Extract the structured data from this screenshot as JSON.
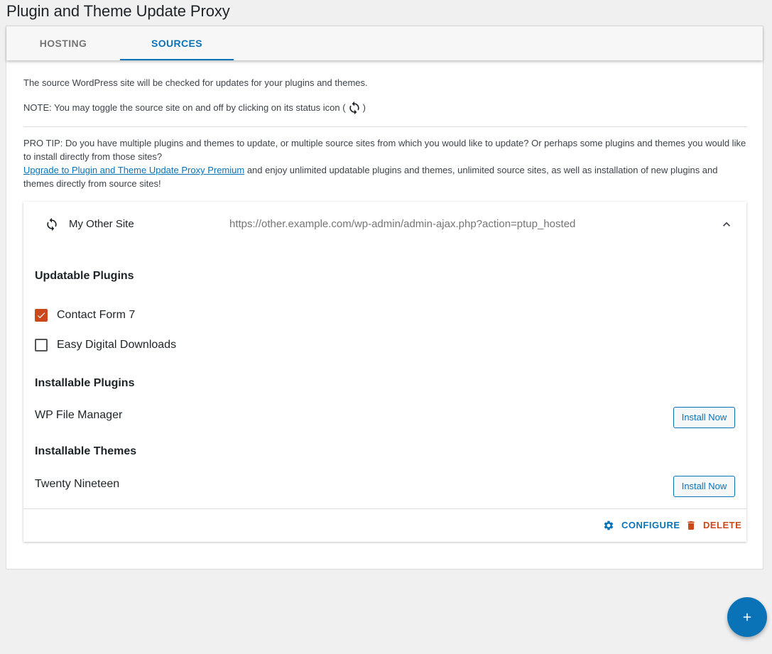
{
  "page": {
    "title": "Plugin and Theme Update Proxy"
  },
  "tabs": [
    {
      "label": "HOSTING",
      "active": false
    },
    {
      "label": "SOURCES",
      "active": true
    }
  ],
  "intro": {
    "description": "The source WordPress site will be checked for updates for your plugins and themes.",
    "note_prefix": "NOTE: You may toggle the source site on and off by clicking on its status icon (",
    "note_suffix": ")",
    "note_icon": "sync-icon"
  },
  "protip": {
    "text_before": "PRO TIP: Do you have multiple plugins and themes to update, or multiple source sites from which you would like to update? Or perhaps some plugins and themes you would like to install directly from those sites?",
    "link_label": "Upgrade to Plugin and Theme Update Proxy Premium",
    "text_after": " and enjoy unlimited updatable plugins and themes, unlimited source sites, as well as installation of new plugins and themes directly from source sites!"
  },
  "source": {
    "name": "My Other Site",
    "url": "https://other.example.com/wp-admin/admin-ajax.php?action=ptup_hosted",
    "expanded": true,
    "status_icon": "sync-icon",
    "updatable_plugins_title": "Updatable Plugins",
    "updatable_plugins": [
      {
        "label": "Contact Form 7",
        "checked": true
      },
      {
        "label": "Easy Digital Downloads",
        "checked": false
      }
    ],
    "installable_plugins_title": "Installable Plugins",
    "installable_plugins": [
      {
        "name": "WP File Manager",
        "button": "Install Now"
      }
    ],
    "installable_themes_title": "Installable Themes",
    "installable_themes": [
      {
        "name": "Twenty Nineteen",
        "button": "Install Now"
      }
    ],
    "actions": {
      "configure": "CONFIGURE",
      "delete": "DELETE"
    }
  },
  "fab": {
    "icon": "plus-icon"
  },
  "colors": {
    "accent": "#0a73b8",
    "danger": "#c9481c",
    "background": "#f0f0f1"
  }
}
